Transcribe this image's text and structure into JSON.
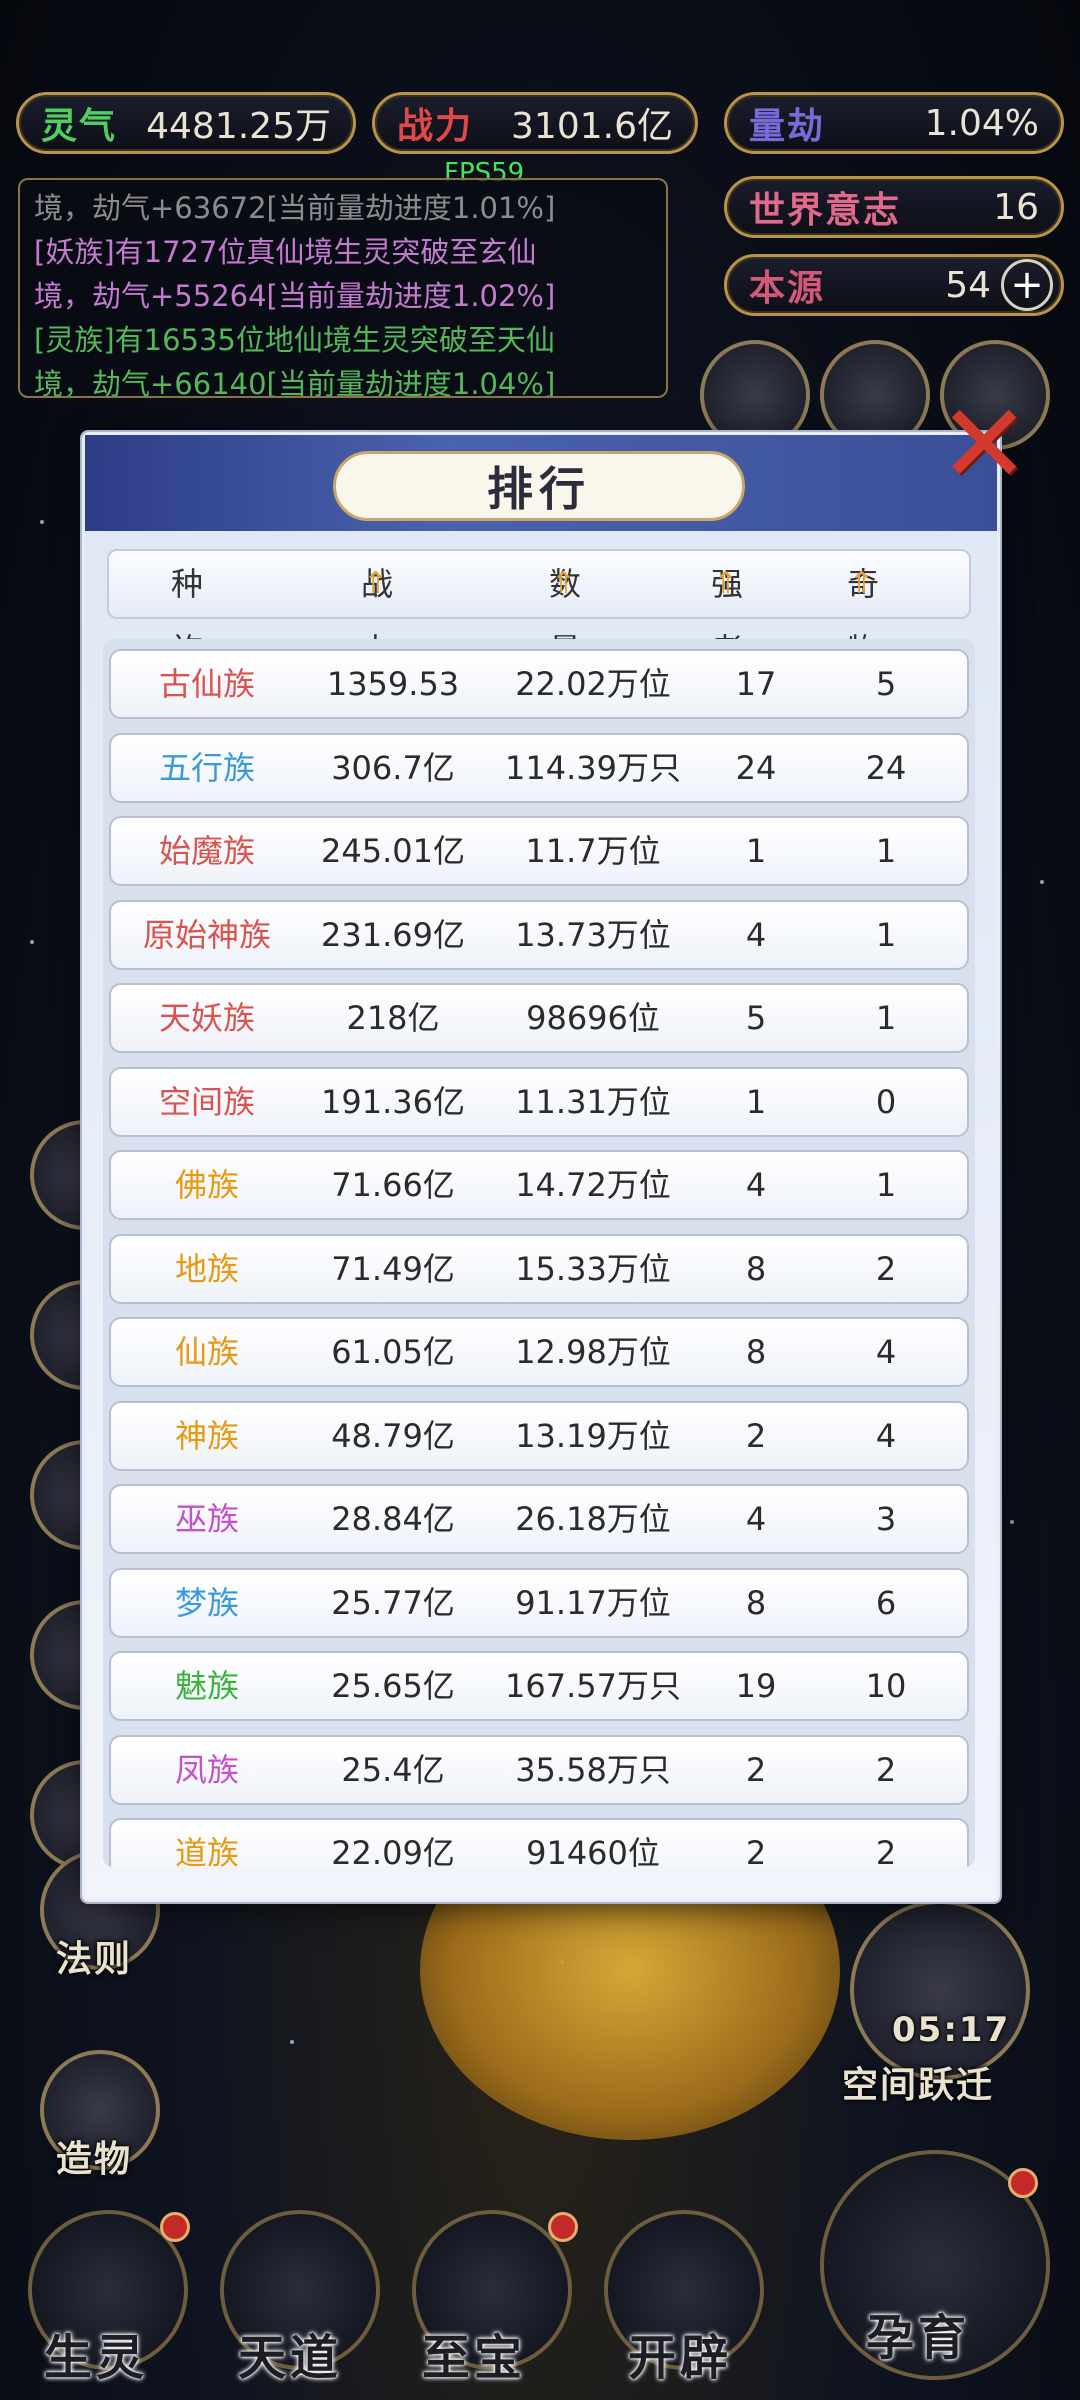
{
  "top_stats": {
    "lingqi": {
      "label": "灵气",
      "value": "4481.25万"
    },
    "zhanli": {
      "label": "战力",
      "value": "3101.6亿"
    },
    "liangjie": {
      "label": "量劫",
      "value": "1.04%"
    },
    "world_will": {
      "label": "世界意志",
      "value": "16"
    },
    "origin": {
      "label": "本源",
      "value": "54"
    }
  },
  "fps_text": "FPS59",
  "log_lines": [
    "境，劫气+63672[当前量劫进度1.01%]",
    "[妖族]有1727位真仙境生灵突破至玄仙",
    "境，劫气+55264[当前量劫进度1.02%]",
    "[灵族]有16535位地仙境生灵突破至天仙",
    "境，劫气+66140[当前量劫进度1.04%]"
  ],
  "dialog": {
    "title": "排行",
    "columns": [
      "种族",
      "战力",
      "数量",
      "强者",
      "奇物"
    ],
    "rows": [
      {
        "name": "古仙族",
        "power": "1359.53亿",
        "count": "22.02万位",
        "strong": "17",
        "items": "5",
        "color": "#d9534f"
      },
      {
        "name": "五行族",
        "power": "306.7亿",
        "count": "114.39万只",
        "strong": "24",
        "items": "24",
        "color": "#3a9ad9"
      },
      {
        "name": "始魔族",
        "power": "245.01亿",
        "count": "11.7万位",
        "strong": "1",
        "items": "1",
        "color": "#d9534f"
      },
      {
        "name": "原始神族",
        "power": "231.69亿",
        "count": "13.73万位",
        "strong": "4",
        "items": "1",
        "color": "#d9534f"
      },
      {
        "name": "天妖族",
        "power": "218亿",
        "count": "98696位",
        "strong": "5",
        "items": "1",
        "color": "#d9534f"
      },
      {
        "name": "空间族",
        "power": "191.36亿",
        "count": "11.31万位",
        "strong": "1",
        "items": "0",
        "color": "#d9534f"
      },
      {
        "name": "佛族",
        "power": "71.66亿",
        "count": "14.72万位",
        "strong": "4",
        "items": "1",
        "color": "#e69a12"
      },
      {
        "name": "地族",
        "power": "71.49亿",
        "count": "15.33万位",
        "strong": "8",
        "items": "2",
        "color": "#e69a12"
      },
      {
        "name": "仙族",
        "power": "61.05亿",
        "count": "12.98万位",
        "strong": "8",
        "items": "4",
        "color": "#e69a12"
      },
      {
        "name": "神族",
        "power": "48.79亿",
        "count": "13.19万位",
        "strong": "2",
        "items": "4",
        "color": "#e69a12"
      },
      {
        "name": "巫族",
        "power": "28.84亿",
        "count": "26.18万位",
        "strong": "4",
        "items": "3",
        "color": "#c651c9"
      },
      {
        "name": "梦族",
        "power": "25.77亿",
        "count": "91.17万位",
        "strong": "8",
        "items": "6",
        "color": "#3a9ad9"
      },
      {
        "name": "魅族",
        "power": "25.65亿",
        "count": "167.57万只",
        "strong": "19",
        "items": "10",
        "color": "#3cb43c"
      },
      {
        "name": "凤族",
        "power": "25.4亿",
        "count": "35.58万只",
        "strong": "2",
        "items": "2",
        "color": "#c651c9"
      },
      {
        "name": "道族",
        "power": "22.09亿",
        "count": "91460位",
        "strong": "2",
        "items": "2",
        "color": "#e69a12"
      }
    ]
  },
  "side_buttons": {
    "law": "法则",
    "create": "造物",
    "jump_time": "05:17",
    "jump": "空间跃迁"
  },
  "bottom_nav": [
    "生灵",
    "天道",
    "至宝",
    "开辟",
    "孕育"
  ]
}
